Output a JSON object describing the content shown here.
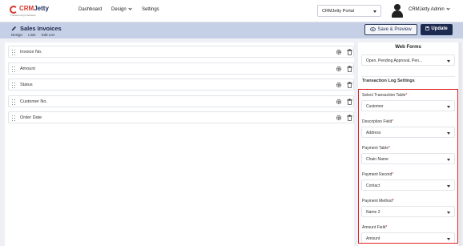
{
  "brand": {
    "name_hl": "CRM",
    "name_rest": "Jetty",
    "tagline": "Transforming Interfaces"
  },
  "nav": {
    "items": [
      {
        "label": "Dashboard"
      },
      {
        "label": "Design"
      },
      {
        "label": "Settings"
      }
    ]
  },
  "portal": {
    "label": "CRMJetty Portal"
  },
  "user": {
    "name": "CRMJetty Admin"
  },
  "page": {
    "title": "Sales Invoices",
    "breadcrumb": [
      "Design",
      "Lists",
      "Edit List"
    ]
  },
  "actions": {
    "save_preview": "Save & Preview",
    "update": "Update"
  },
  "fields": [
    {
      "label": "Invoice No."
    },
    {
      "label": "Amount"
    },
    {
      "label": "Status"
    },
    {
      "label": "Customer No."
    },
    {
      "label": "Order Date"
    }
  ],
  "web_forms": {
    "title": "Web Forms",
    "selected": "Open, Pending Approval, Pen..."
  },
  "transaction_log": {
    "title": "Transaction Log Settings",
    "fields": [
      {
        "label": "Select Transaction Table",
        "value": "Customer"
      },
      {
        "label": "Description Field",
        "value": "Address"
      },
      {
        "label": "Payment Table",
        "value": "Chain Name"
      },
      {
        "label": "Payment Record",
        "value": "Contact"
      },
      {
        "label": "Payment Method",
        "value": "Name 2"
      },
      {
        "label": "Amount Field",
        "value": "Amount"
      }
    ]
  },
  "colors": {
    "accent": "#1d2a4f",
    "highlight": "#e02020",
    "subheader": "#c5d0e6",
    "brand_red": "#d9362a"
  },
  "icons": [
    "drag-handle-icon",
    "gear-icon",
    "trash-icon",
    "pencil-icon",
    "user-avatar-icon",
    "eye-icon",
    "save-icon",
    "chevron-down-icon"
  ]
}
